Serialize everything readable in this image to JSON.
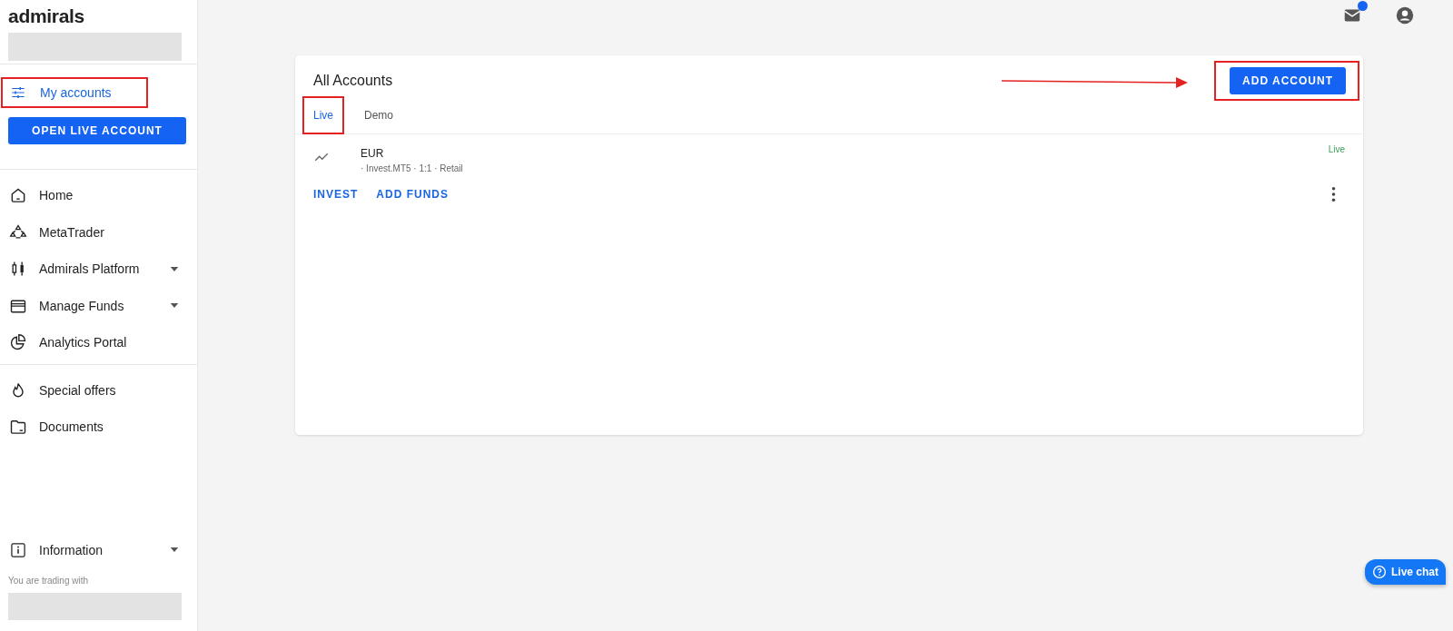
{
  "sidebar": {
    "logo": "admirals",
    "my_accounts": {
      "label": "My accounts",
      "selected": true,
      "highlighted": true
    },
    "open_live_button": "OPEN LIVE ACCOUNT",
    "sections": [
      [
        {
          "label": "Home",
          "has_submenu": false
        },
        {
          "label": "MetaTrader",
          "has_submenu": false
        },
        {
          "label": "Admirals Platform",
          "has_submenu": true
        },
        {
          "label": "Manage Funds",
          "has_submenu": true
        },
        {
          "label": "Analytics Portal",
          "has_submenu": false
        }
      ],
      [
        {
          "label": "Special offers",
          "has_submenu": false
        },
        {
          "label": "Documents",
          "has_submenu": false
        }
      ]
    ],
    "information": {
      "label": "Information",
      "has_submenu": true
    },
    "trading_with": "You are trading with"
  },
  "topbar": {
    "mail_unread": true
  },
  "card": {
    "title": "All Accounts",
    "add_button": {
      "label": "ADD ACCOUNT",
      "highlighted": true,
      "pointed_at": true
    },
    "tabs": [
      {
        "label": "Live",
        "selected": true,
        "highlighted": true
      },
      {
        "label": "Demo",
        "selected": false,
        "highlighted": false
      }
    ],
    "accounts": [
      {
        "currency": "EUR",
        "details": "· Invest.MT5 · 1:1 · Retail",
        "status": "Live",
        "actions": [
          "INVEST",
          "ADD FUNDS"
        ]
      }
    ]
  },
  "live_chat": "Live chat"
}
